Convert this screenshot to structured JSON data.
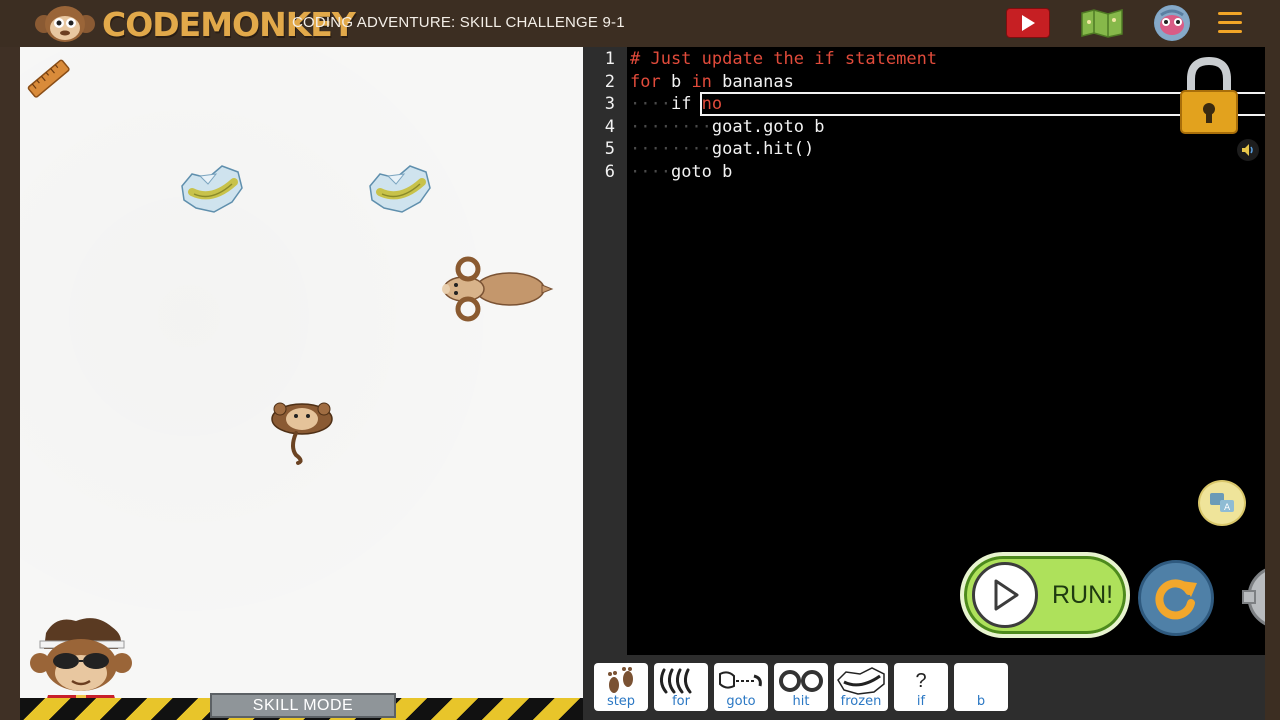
{
  "header": {
    "logo_text": "CODEMONKEY",
    "title": "CODING ADVENTURE: SKILL CHALLENGE 9-1",
    "icons": [
      "monkey-logo-icon",
      "video-play-icon",
      "map-icon",
      "avatar-icon",
      "hamburger-menu-icon"
    ]
  },
  "stage": {
    "skill_mode_label": "SKILL MODE",
    "sprites": [
      "ruler-icon",
      "frozen-banana-icon",
      "frozen-banana-icon",
      "goat-icon",
      "monkey-icon",
      "monkey-guide-icon"
    ]
  },
  "editor": {
    "line_numbers": [
      "1",
      "2",
      "3",
      "4",
      "5",
      "6"
    ],
    "lines": [
      {
        "indent": "",
        "text": "# Just update the if statement"
      },
      {
        "indent": "",
        "kw1": "for",
        "mid": " b ",
        "kw2": "in",
        "rest": " bananas"
      },
      {
        "indent": "····",
        "text_before": "if ",
        "typed": "no"
      },
      {
        "indent": "········",
        "text": "goat.goto b"
      },
      {
        "indent": "········",
        "text": "goat.hit()"
      },
      {
        "indent": "····",
        "text": "goto b"
      }
    ],
    "icons": [
      "padlock-icon",
      "speaker-icon",
      "translate-icon",
      "settings-gear-icon"
    ]
  },
  "controls": {
    "run_label": "RUN!",
    "reset_icon": "reset-arrow-icon"
  },
  "toolbox": {
    "items": [
      {
        "label": "step",
        "icon": "footprints-icon"
      },
      {
        "label": "for",
        "icon": "bananas-icon"
      },
      {
        "label": "goto",
        "icon": "goto-hand-icon"
      },
      {
        "label": "hit",
        "icon": "horns-icon"
      },
      {
        "label": "frozen",
        "icon": "frozen-banana-icon"
      },
      {
        "label": "if",
        "icon": "question-mark-icon",
        "glyph": "?"
      },
      {
        "label": "b",
        "icon": "blank-icon"
      }
    ]
  },
  "colors": {
    "header_bg": "#3c2e22",
    "accent_orange": "#f1a527",
    "keyword_red": "#e14b3b",
    "run_green": "#aee15b",
    "toolbox_label_blue": "#2b78c4"
  }
}
